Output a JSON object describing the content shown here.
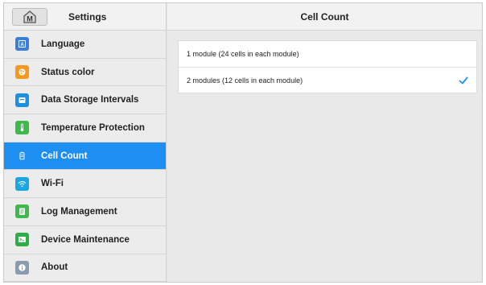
{
  "sidebar": {
    "title": "Settings",
    "items": [
      {
        "label": "Language",
        "icon": "language-icon",
        "color": "#3b7fd9"
      },
      {
        "label": "Status color",
        "icon": "palette-icon",
        "color": "#f39a1e"
      },
      {
        "label": "Data Storage Intervals",
        "icon": "storage-icon",
        "color": "#1e90e0"
      },
      {
        "label": "Temperature Protection",
        "icon": "thermometer-icon",
        "color": "#3dbb4a"
      },
      {
        "label": "Cell Count",
        "icon": "battery-icon",
        "color": "#1e8ff2",
        "active": true
      },
      {
        "label": "Wi-Fi",
        "icon": "wifi-icon",
        "color": "#1ca6e0"
      },
      {
        "label": "Log Management",
        "icon": "log-icon",
        "color": "#3dbb4a"
      },
      {
        "label": "Device Maintenance",
        "icon": "terminal-icon",
        "color": "#2fae47"
      },
      {
        "label": "About",
        "icon": "info-icon",
        "color": "#8a9bad"
      }
    ]
  },
  "main": {
    "title": "Cell Count",
    "options": [
      {
        "label": "1 module (24 cells in each module)",
        "selected": false
      },
      {
        "label": "2 modules (12 cells in each module)",
        "selected": true
      }
    ]
  },
  "colors": {
    "accent": "#1e8ff2",
    "check": "#1e8ff2"
  }
}
